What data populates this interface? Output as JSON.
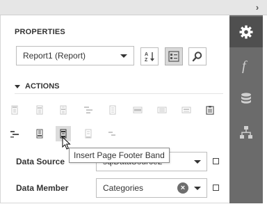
{
  "properties_title": "PROPERTIES",
  "report_selector": {
    "value": "Report1 (Report)"
  },
  "actions_title": "ACTIONS",
  "tooltip_text": "Insert Page Footer Band",
  "data_source": {
    "label": "Data Source",
    "value": "sqlDataSource2"
  },
  "data_member": {
    "label": "Data Member",
    "value": "Categories"
  },
  "sidebar_tabs": [
    "properties-gear-icon",
    "expressions-function-icon",
    "field-list-database-icon",
    "report-explorer-hierarchy-icon"
  ],
  "colors": {
    "sidebar": "#6b6b6b",
    "sidebar_active": "#4f4f4f",
    "icon_light": "#c8c8c8",
    "icon_dark": "#555555"
  }
}
